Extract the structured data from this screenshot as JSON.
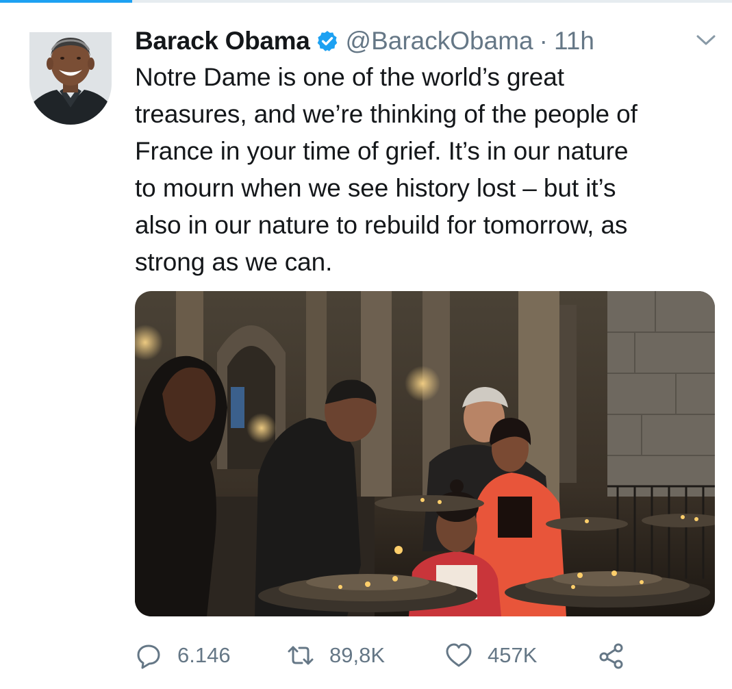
{
  "tab_indicator": {
    "color": "#1da1f2"
  },
  "author": {
    "name": "Barack Obama",
    "verified": true,
    "handle": "@BarackObama",
    "separator": "·",
    "time": "11h",
    "avatar_icon": "profile-photo"
  },
  "tweet": {
    "lines": [
      "Notre Dame is one of the world’s great",
      "treasures, and we’re thinking of the people of",
      "France in your time of grief. It’s in our nature",
      "to mourn when we see history lost – but it’s",
      "also in our nature to rebuild for tomorrow, as",
      "strong as we can."
    ]
  },
  "media": {
    "type": "photo"
  },
  "actions": {
    "reply": {
      "icon": "reply-icon",
      "count": "6.146"
    },
    "retweet": {
      "icon": "retweet-icon",
      "count": "89,8K"
    },
    "like": {
      "icon": "heart-icon",
      "count": "457K"
    },
    "share": {
      "icon": "share-icon"
    }
  },
  "colors": {
    "accent": "#1da1f2",
    "secondary_text": "#657786",
    "primary_text": "#14171a"
  }
}
